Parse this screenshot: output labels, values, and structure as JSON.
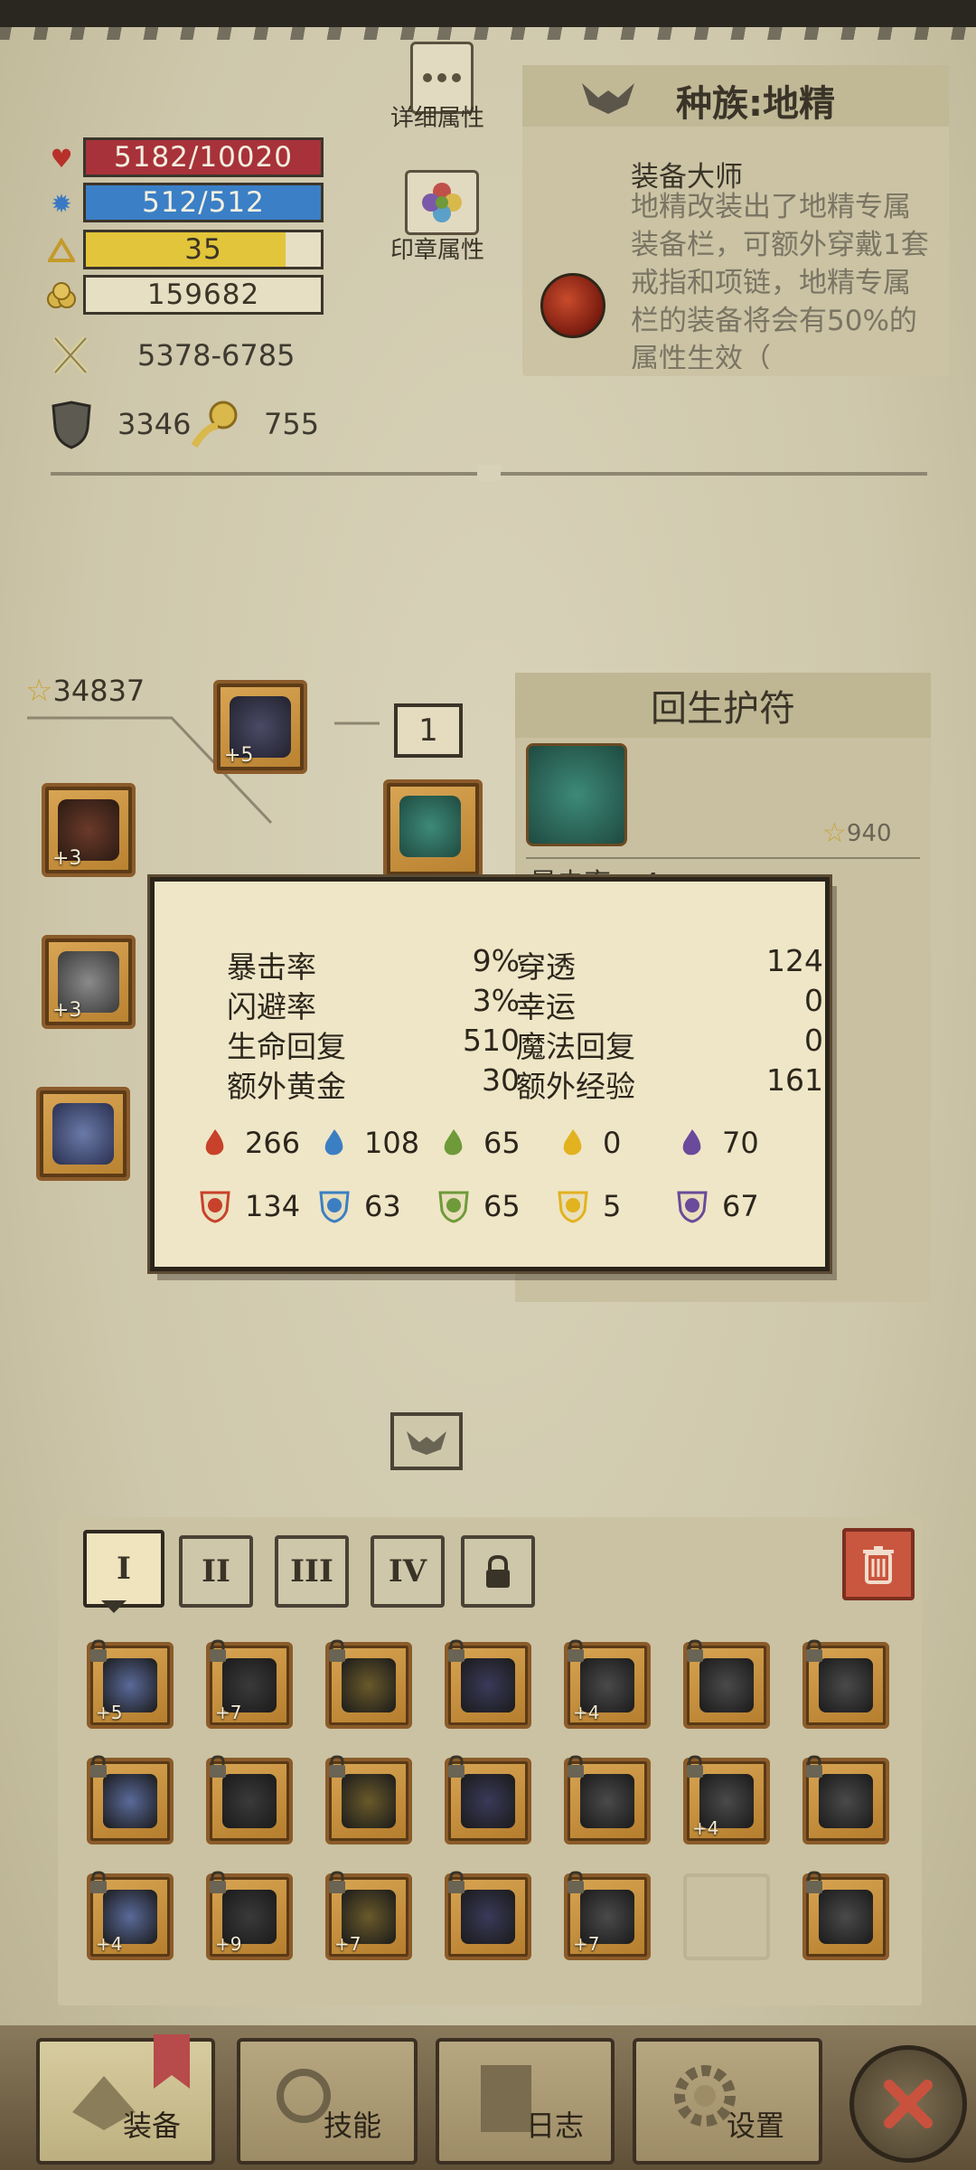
{
  "stats": {
    "hp": "5182/10020",
    "hp_fraction": 0.517,
    "mp": "512/512",
    "mp_fraction": 1.0,
    "level": "35",
    "level_fraction": 0.85,
    "gold": "159682",
    "attack": "5378-6785",
    "defense": "3346",
    "speed": "755"
  },
  "side_buttons": {
    "detail_label": "详细属性",
    "seal_label": "印章属性"
  },
  "race": {
    "title": "种族:地精",
    "skill_name": "装备大师",
    "skill_desc": "地精改装出了地精专属装备栏，可额外穿戴1套戒指和项链，地精专属栏的装备将会有50%的属性生效（"
  },
  "equipment": {
    "score": "34837",
    "slot_badge": "1",
    "plus_values": [
      "+5",
      "+3",
      "+3"
    ]
  },
  "item_panel": {
    "title": "回生护符",
    "score": "940",
    "partial_stat": "暴击率 +4"
  },
  "tooltip": {
    "rows": [
      {
        "l1": "暴击率",
        "v1": "9%",
        "l2": "穿透",
        "v2": "124"
      },
      {
        "l1": "闪避率",
        "v1": "3%",
        "l2": "幸运",
        "v2": "0"
      },
      {
        "l1": "生命回复",
        "v1": "510",
        "l2": "魔法回复",
        "v2": "0"
      },
      {
        "l1": "额外黄金",
        "v1": "30",
        "l2": "额外经验",
        "v2": "161"
      }
    ],
    "attack_elements": [
      "266",
      "108",
      "65",
      "0",
      "70"
    ],
    "defense_elements": [
      "134",
      "63",
      "65",
      "5",
      "67"
    ],
    "element_colors": [
      "#c8412a",
      "#3b7fc2",
      "#6e9a3a",
      "#e2b21f",
      "#6a4a9a"
    ]
  },
  "inventory": {
    "tabs": [
      "I",
      "II",
      "III",
      "IV"
    ],
    "plus_row1": [
      "+5",
      "+7",
      "",
      "",
      "+4",
      "",
      ""
    ],
    "plus_row2": [
      "",
      "",
      "",
      "",
      "",
      "+4",
      ""
    ],
    "plus_row3": [
      "+4",
      "+9",
      "+7",
      "",
      "+7",
      "",
      ""
    ]
  },
  "nav": {
    "equip": "装备",
    "skill": "技能",
    "log": "日志",
    "settings": "设置"
  }
}
